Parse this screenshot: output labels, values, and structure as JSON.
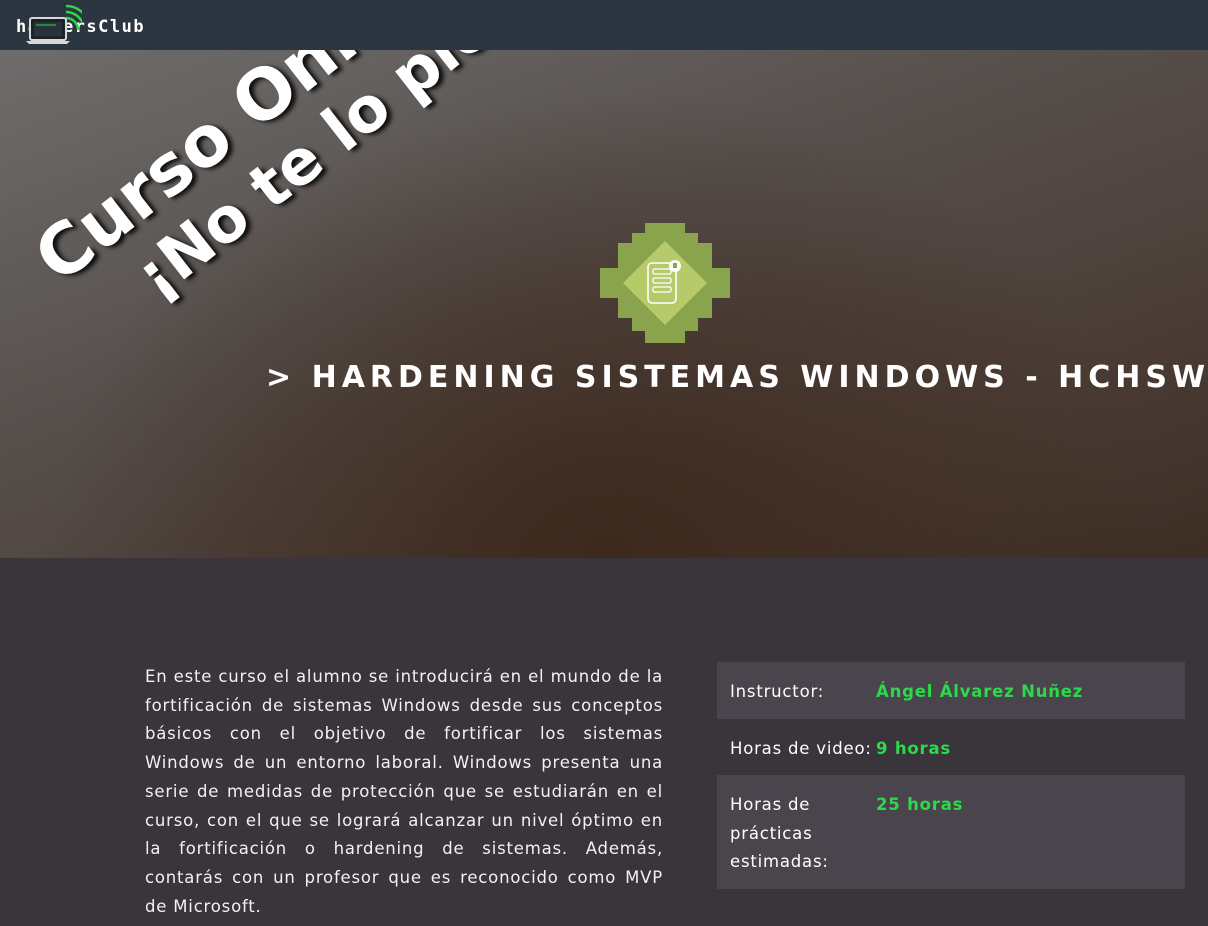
{
  "header": {
    "logo_text": "hackersClub",
    "accent_color": "#2bd94a",
    "bar_color": "#2c3640"
  },
  "hero": {
    "title": "> HARDENING SISTEMAS WINDOWS - HCHSW",
    "promo_line1": "Curso Online",
    "promo_line2": "¡No te lo pierdas!!",
    "badge_icon": "server-icon",
    "badge_color": "#8aa34d"
  },
  "course": {
    "description": "En este curso el alumno se introducirá en el mundo de la fortificación de sistemas Windows desde sus conceptos básicos con el objetivo de fortificar los sistemas Windows de un entorno laboral. Windows presenta una serie de medidas de protección que se estudiarán en el curso, con el que se logrará alcanzar un nivel óptimo en la fortificación o hardening de sistemas. Además, contarás con un profesor que es reconocido como MVP de Microsoft.",
    "info": [
      {
        "label": "Instructor:",
        "value": "Ángel Álvarez Nuñez"
      },
      {
        "label": "Horas de video:",
        "value": "9 horas"
      },
      {
        "label": "Horas de prácticas estimadas:",
        "value": "25 horas"
      }
    ]
  }
}
